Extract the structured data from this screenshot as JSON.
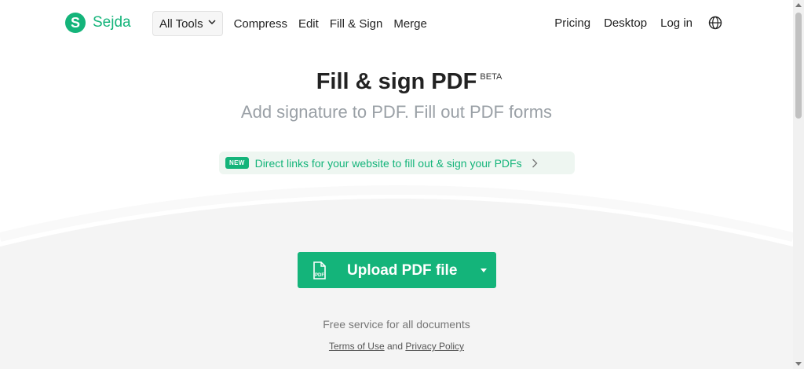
{
  "colors": {
    "brand": "#14b47a",
    "grey_area": "#f4f4f4"
  },
  "nav": {
    "logo_letter": "S",
    "logo_text": "Sejda",
    "all_tools": "All Tools",
    "links": [
      "Compress",
      "Edit",
      "Fill & Sign",
      "Merge"
    ],
    "right_links": [
      "Pricing",
      "Desktop",
      "Log in"
    ],
    "language_icon": "globe-icon"
  },
  "hero": {
    "title": "Fill & sign PDF",
    "badge": "BETA",
    "subtitle": "Add signature to PDF. Fill out PDF forms"
  },
  "promo": {
    "badge": "NEW",
    "text": "Direct links for your website to fill out & sign your PDFs"
  },
  "upload": {
    "label": "Upload PDF file",
    "icon_text": "PDF"
  },
  "footer": {
    "free_text": "Free service for all documents",
    "terms": "Terms of Use",
    "and": "and",
    "privacy": "Privacy Policy"
  }
}
